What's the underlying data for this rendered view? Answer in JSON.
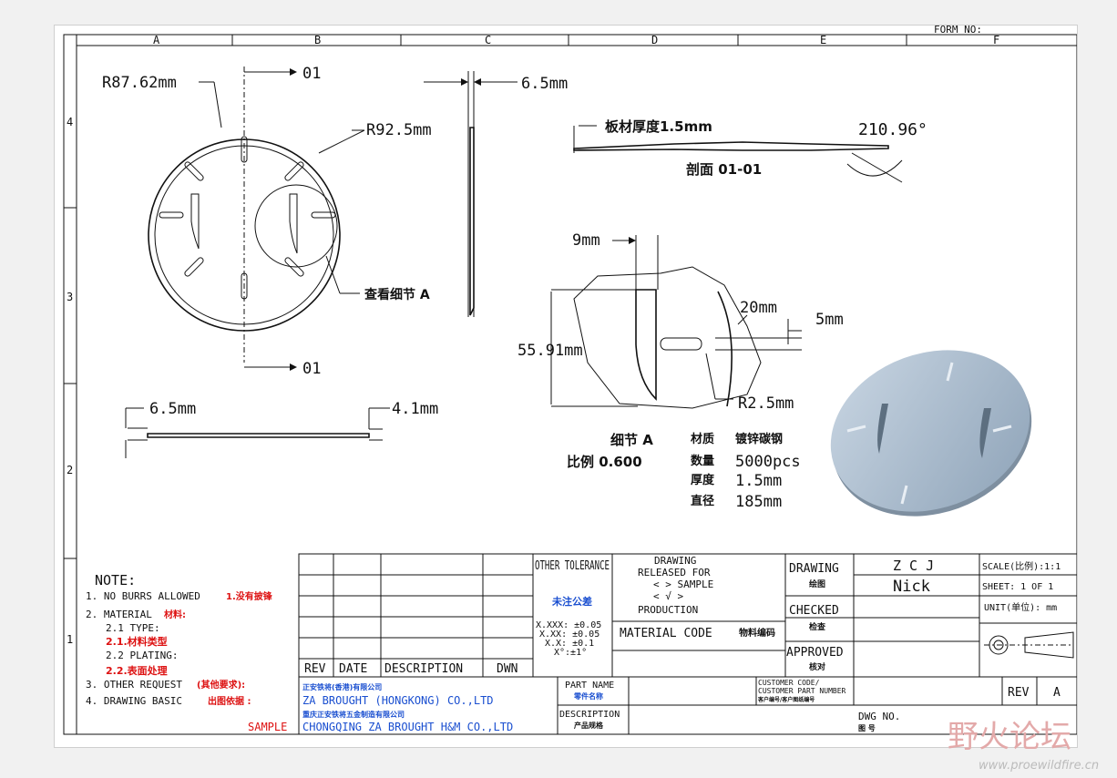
{
  "form_no": "FORM NO:",
  "col_labels": [
    "A",
    "B",
    "C",
    "D",
    "E",
    "F"
  ],
  "row_labels": [
    "4",
    "3",
    "2",
    "1"
  ],
  "views": {
    "r1": "R87.62mm",
    "r2": "R92.5mm",
    "section_a": "01",
    "section_b": "01",
    "detail_callout": "查看细节  A",
    "thick_top": "6.5mm",
    "thick_left": "6.5mm",
    "height_left": "4.1mm",
    "plate_thickness": "板材厚度1.5mm",
    "angle": "210.96°",
    "section_label": "剖面  01-01",
    "dim_9": "9mm",
    "dim_20": "20mm",
    "dim_5": "5mm",
    "dim_55": "55.91mm",
    "dim_r25": "R2.5mm",
    "detail_title": "细节  A",
    "detail_scale": "比例 0.600"
  },
  "specs": [
    {
      "label": "材质",
      "value": "镀锌碳钢"
    },
    {
      "label": "数量",
      "value": "5000pcs"
    },
    {
      "label": "厚度",
      "value": "1.5mm"
    },
    {
      "label": "直径",
      "value": "185mm"
    }
  ],
  "notes": {
    "title": "NOTE:",
    "l1": "1. NO BURRS ALLOWED",
    "l1_cn": "1.没有披锋",
    "l2": "2. MATERIAL",
    "l2_cn": "材料:",
    "l3": "2.1 TYPE:",
    "l3_cn": "2.1.材料类型",
    "l4": "2.2 PLATING:",
    "l4_cn": "2.2.表面处理",
    "l5": "3. OTHER REQUEST",
    "l5_cn": "(其他要求):",
    "l6": "4. DRAWING BASIC",
    "l6_cn": "出图依据 :",
    "sample": "SAMPLE"
  },
  "title_block": {
    "rev_headers": [
      "REV",
      "DATE",
      "DESCRIPTION",
      "DWN"
    ],
    "other_tolerance": "OTHER TOLERANCE",
    "unspecified_tol": "未注公差",
    "tol1": "X.XXX: ±0.05",
    "tol2": "X.XX: ±0.05",
    "tol3": "X.X: ±0.1",
    "tol4": "X°:±1°",
    "drawing_released": "DRAWING",
    "released_for": "RELEASED FOR",
    "sample_opt": "<     > SAMPLE",
    "check_opt": "<  √  >",
    "production": "PRODUCTION",
    "material_code": "MATERIAL CODE",
    "material_code_cn": "物料编码",
    "drawing": "DRAWING",
    "drawing_cn": "绘图",
    "checked": "CHECKED",
    "checked_cn": "检查",
    "approved": "APPROVED",
    "approved_cn": "核对",
    "drawn_by": "Z C J",
    "checked_by": "Nick",
    "scale": "SCALE(比例):1:1",
    "sheet": "SHEET: 1 OF 1",
    "unit": "UNIT(单位): mm",
    "company_cn1": "正安铁将(香港)有限公司",
    "company1": "ZA BROUGHT (HONGKONG) CO.,LTD",
    "company_cn2": "重庆正安铁将五金制造有限公司",
    "company2": "CHONGQING ZA BROUGHT H&M CO.,LTD",
    "part_name": "PART NAME",
    "part_name_cn": "零件名称",
    "description": "DESCRIPTION",
    "description_cn": "产品规格",
    "customer_code": "CUSTOMER CODE/",
    "customer_part": "CUSTOMER PART NUMBER",
    "customer_cn": "客户编号/客户图纸编号",
    "rev": "REV",
    "rev_val": "A",
    "dwg_no": "DWG NO.",
    "dwg_no_cn": "图  号"
  },
  "watermark": {
    "cn": "野火论坛",
    "url": "www.proewildfire.cn"
  }
}
